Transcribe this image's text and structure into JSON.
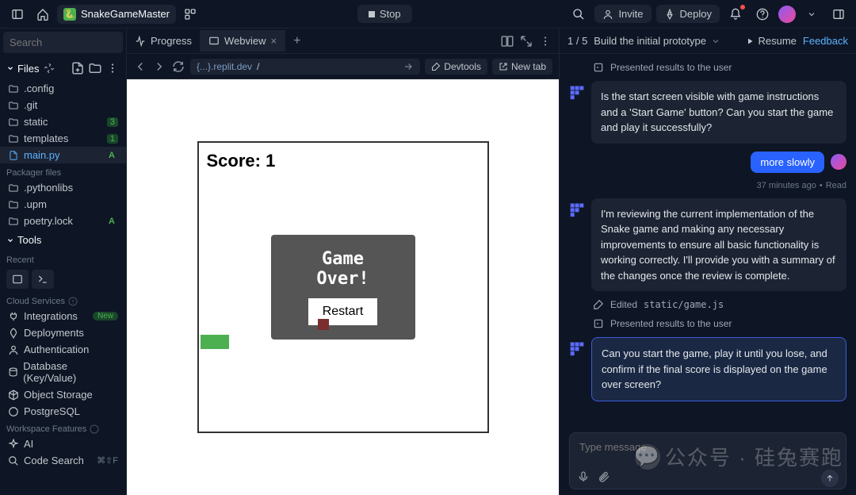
{
  "header": {
    "project_name": "SnakeGameMaster",
    "stop_label": "Stop",
    "invite_label": "Invite",
    "deploy_label": "Deploy"
  },
  "sidebar": {
    "search_placeholder": "Search",
    "files_label": "Files",
    "items": [
      {
        "name": ".config",
        "type": "folder"
      },
      {
        "name": ".git",
        "type": "folder"
      },
      {
        "name": "static",
        "type": "folder",
        "badge": "3"
      },
      {
        "name": "templates",
        "type": "folder",
        "badge": "1"
      },
      {
        "name": "main.py",
        "type": "file",
        "badge": "A",
        "active": true
      }
    ],
    "packager_label": "Packager files",
    "packager_items": [
      {
        "name": ".pythonlibs"
      },
      {
        "name": ".upm"
      },
      {
        "name": "poetry.lock",
        "badge": "A"
      }
    ],
    "tools_label": "Tools",
    "recent_label": "Recent",
    "cloud_label": "Cloud Services",
    "cloud_items": [
      {
        "name": "Integrations",
        "pill": "New",
        "icon": "plug"
      },
      {
        "name": "Deployments",
        "icon": "rocket"
      },
      {
        "name": "Authentication",
        "icon": "user"
      },
      {
        "name": "Database (Key/Value)",
        "icon": "db"
      },
      {
        "name": "Object Storage",
        "icon": "cube"
      },
      {
        "name": "PostgreSQL",
        "icon": "elephant"
      }
    ],
    "workspace_label": "Workspace Features",
    "workspace_items": [
      {
        "name": "AI",
        "icon": "sparkle"
      },
      {
        "name": "Code Search",
        "icon": "search",
        "shortcut": "⌘⇧F"
      }
    ]
  },
  "tabs": {
    "items": [
      {
        "label": "Progress",
        "active": false
      },
      {
        "label": "Webview",
        "active": true
      }
    ]
  },
  "urlbar": {
    "domain": "{...}.replit.dev",
    "path": "/",
    "devtools_label": "Devtools",
    "newtab_label": "New tab"
  },
  "game": {
    "score_label": "Score: 1",
    "game_over_label": "Game Over!",
    "restart_label": "Restart"
  },
  "chat": {
    "step_indicator": "1 / 5",
    "step_title": "Build the initial prototype",
    "resume_label": "Resume",
    "feedback_label": "Feedback",
    "presented_label": "Presented results to the user",
    "q1": "Is the start screen visible with game instructions and a 'Start Game' button? Can you start the game and play it successfully?",
    "user_reply": "more slowly",
    "timestamp": "37 minutes ago",
    "read_label": "Read",
    "review_msg": "I'm reviewing the current implementation of the Snake game and making any necessary improvements to ensure all basic functionality is working correctly. I'll provide you with a summary of the changes once the review is complete.",
    "edited_label": "Edited",
    "edited_file": "static/game.js",
    "q2": "Can you start the game, play it until you lose, and confirm if the final score is displayed on the game over screen?",
    "input_placeholder": "Type message"
  },
  "watermark": "公众号 · 硅兔赛跑"
}
